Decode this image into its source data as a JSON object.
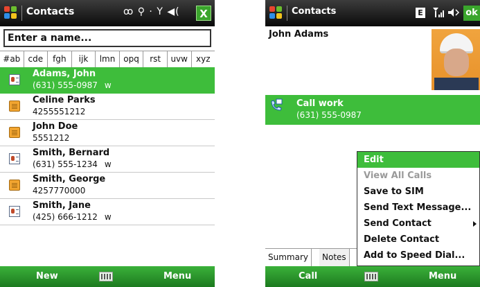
{
  "left": {
    "title": "Contacts",
    "status_icons": "ꝏ ⚲ · Y ◀(",
    "close_label": "X",
    "search_placeholder": "Enter a name...",
    "alpha_tabs": [
      "#ab",
      "cde",
      "fgh",
      "ijk",
      "lmn",
      "opq",
      "rst",
      "uvw",
      "xyz"
    ],
    "contacts": [
      {
        "name": "Adams, John",
        "phone": "(631) 555-0987",
        "type": "w",
        "icon": "contact-card-icon",
        "selected": true
      },
      {
        "name": "Celine Parks",
        "phone": "4255551212",
        "type": "",
        "icon": "sim-card-icon",
        "selected": false
      },
      {
        "name": "John Doe",
        "phone": "5551212",
        "type": "",
        "icon": "sim-card-icon",
        "selected": false
      },
      {
        "name": "Smith, Bernard",
        "phone": "(631) 555-1234",
        "type": "w",
        "icon": "contact-card-icon",
        "selected": false
      },
      {
        "name": "Smith, George",
        "phone": "4257770000",
        "type": "",
        "icon": "sim-card-icon",
        "selected": false
      },
      {
        "name": "Smith, Jane",
        "phone": "(425) 666-1212",
        "type": "w",
        "icon": "contact-card-icon",
        "selected": false
      }
    ],
    "softkeys": {
      "left": "New",
      "right": "Menu"
    }
  },
  "right": {
    "title": "Contacts",
    "edge_badge": "E",
    "ok_label": "ok",
    "contact_name": "John Adams",
    "call_label": "Call work",
    "call_number": "(631) 555-0987",
    "tabs": [
      "Summary",
      "Notes"
    ],
    "menu": [
      {
        "label": "Edit",
        "state": "selected",
        "submenu": false
      },
      {
        "label": "View All Calls",
        "state": "disabled",
        "submenu": false
      },
      {
        "label": "Save to SIM",
        "state": "normal",
        "submenu": false
      },
      {
        "label": "Send Text Message...",
        "state": "normal",
        "submenu": false
      },
      {
        "label": "Send Contact",
        "state": "normal",
        "submenu": true
      },
      {
        "label": "Delete Contact",
        "state": "normal",
        "submenu": false
      },
      {
        "label": "Add to Speed Dial...",
        "state": "normal",
        "submenu": false
      }
    ],
    "softkeys": {
      "left": "Call",
      "right": "Menu"
    }
  },
  "colors": {
    "accent": "#3ebd3b",
    "titlebar": "#1a1a1a"
  }
}
